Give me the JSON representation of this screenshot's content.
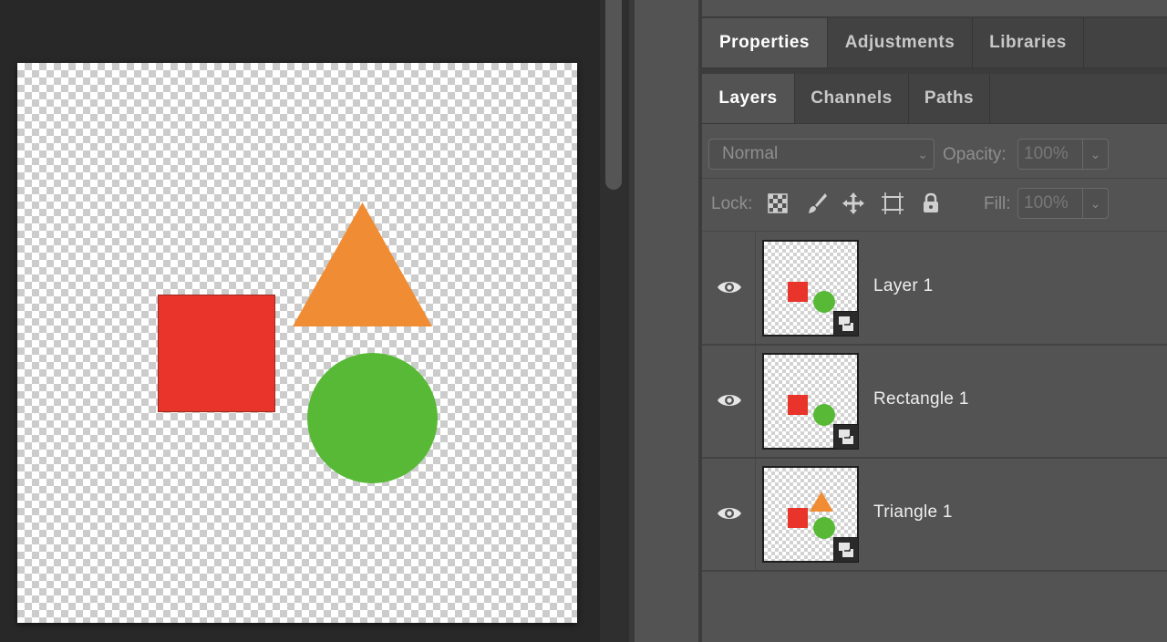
{
  "colors": {
    "red": "#e8342a",
    "orange": "#ef8c34",
    "green": "#58b937"
  },
  "panels": {
    "top_tabs": [
      {
        "label": "Properties",
        "active": true
      },
      {
        "label": "Adjustments",
        "active": false
      },
      {
        "label": "Libraries",
        "active": false
      }
    ],
    "layer_tabs": [
      {
        "label": "Layers",
        "active": true
      },
      {
        "label": "Channels",
        "active": false
      },
      {
        "label": "Paths",
        "active": false
      }
    ]
  },
  "layers_panel": {
    "blend_mode": "Normal",
    "opacity_label": "Opacity:",
    "opacity_value": "100%",
    "lock_label": "Lock:",
    "fill_label": "Fill:",
    "fill_value": "100%",
    "lock_icons": [
      "lock-transparent-pixels-icon",
      "lock-image-pixels-icon",
      "lock-position-icon",
      "lock-artboard-icon",
      "lock-all-icon"
    ],
    "layers": [
      {
        "name": "Layer 1",
        "visible": true,
        "thumb": [
          "rect",
          "circle"
        ]
      },
      {
        "name": "Rectangle 1",
        "visible": true,
        "thumb": [
          "rect",
          "circle"
        ]
      },
      {
        "name": "Triangle 1",
        "visible": true,
        "thumb": [
          "rect",
          "circle",
          "triangle"
        ]
      }
    ]
  }
}
